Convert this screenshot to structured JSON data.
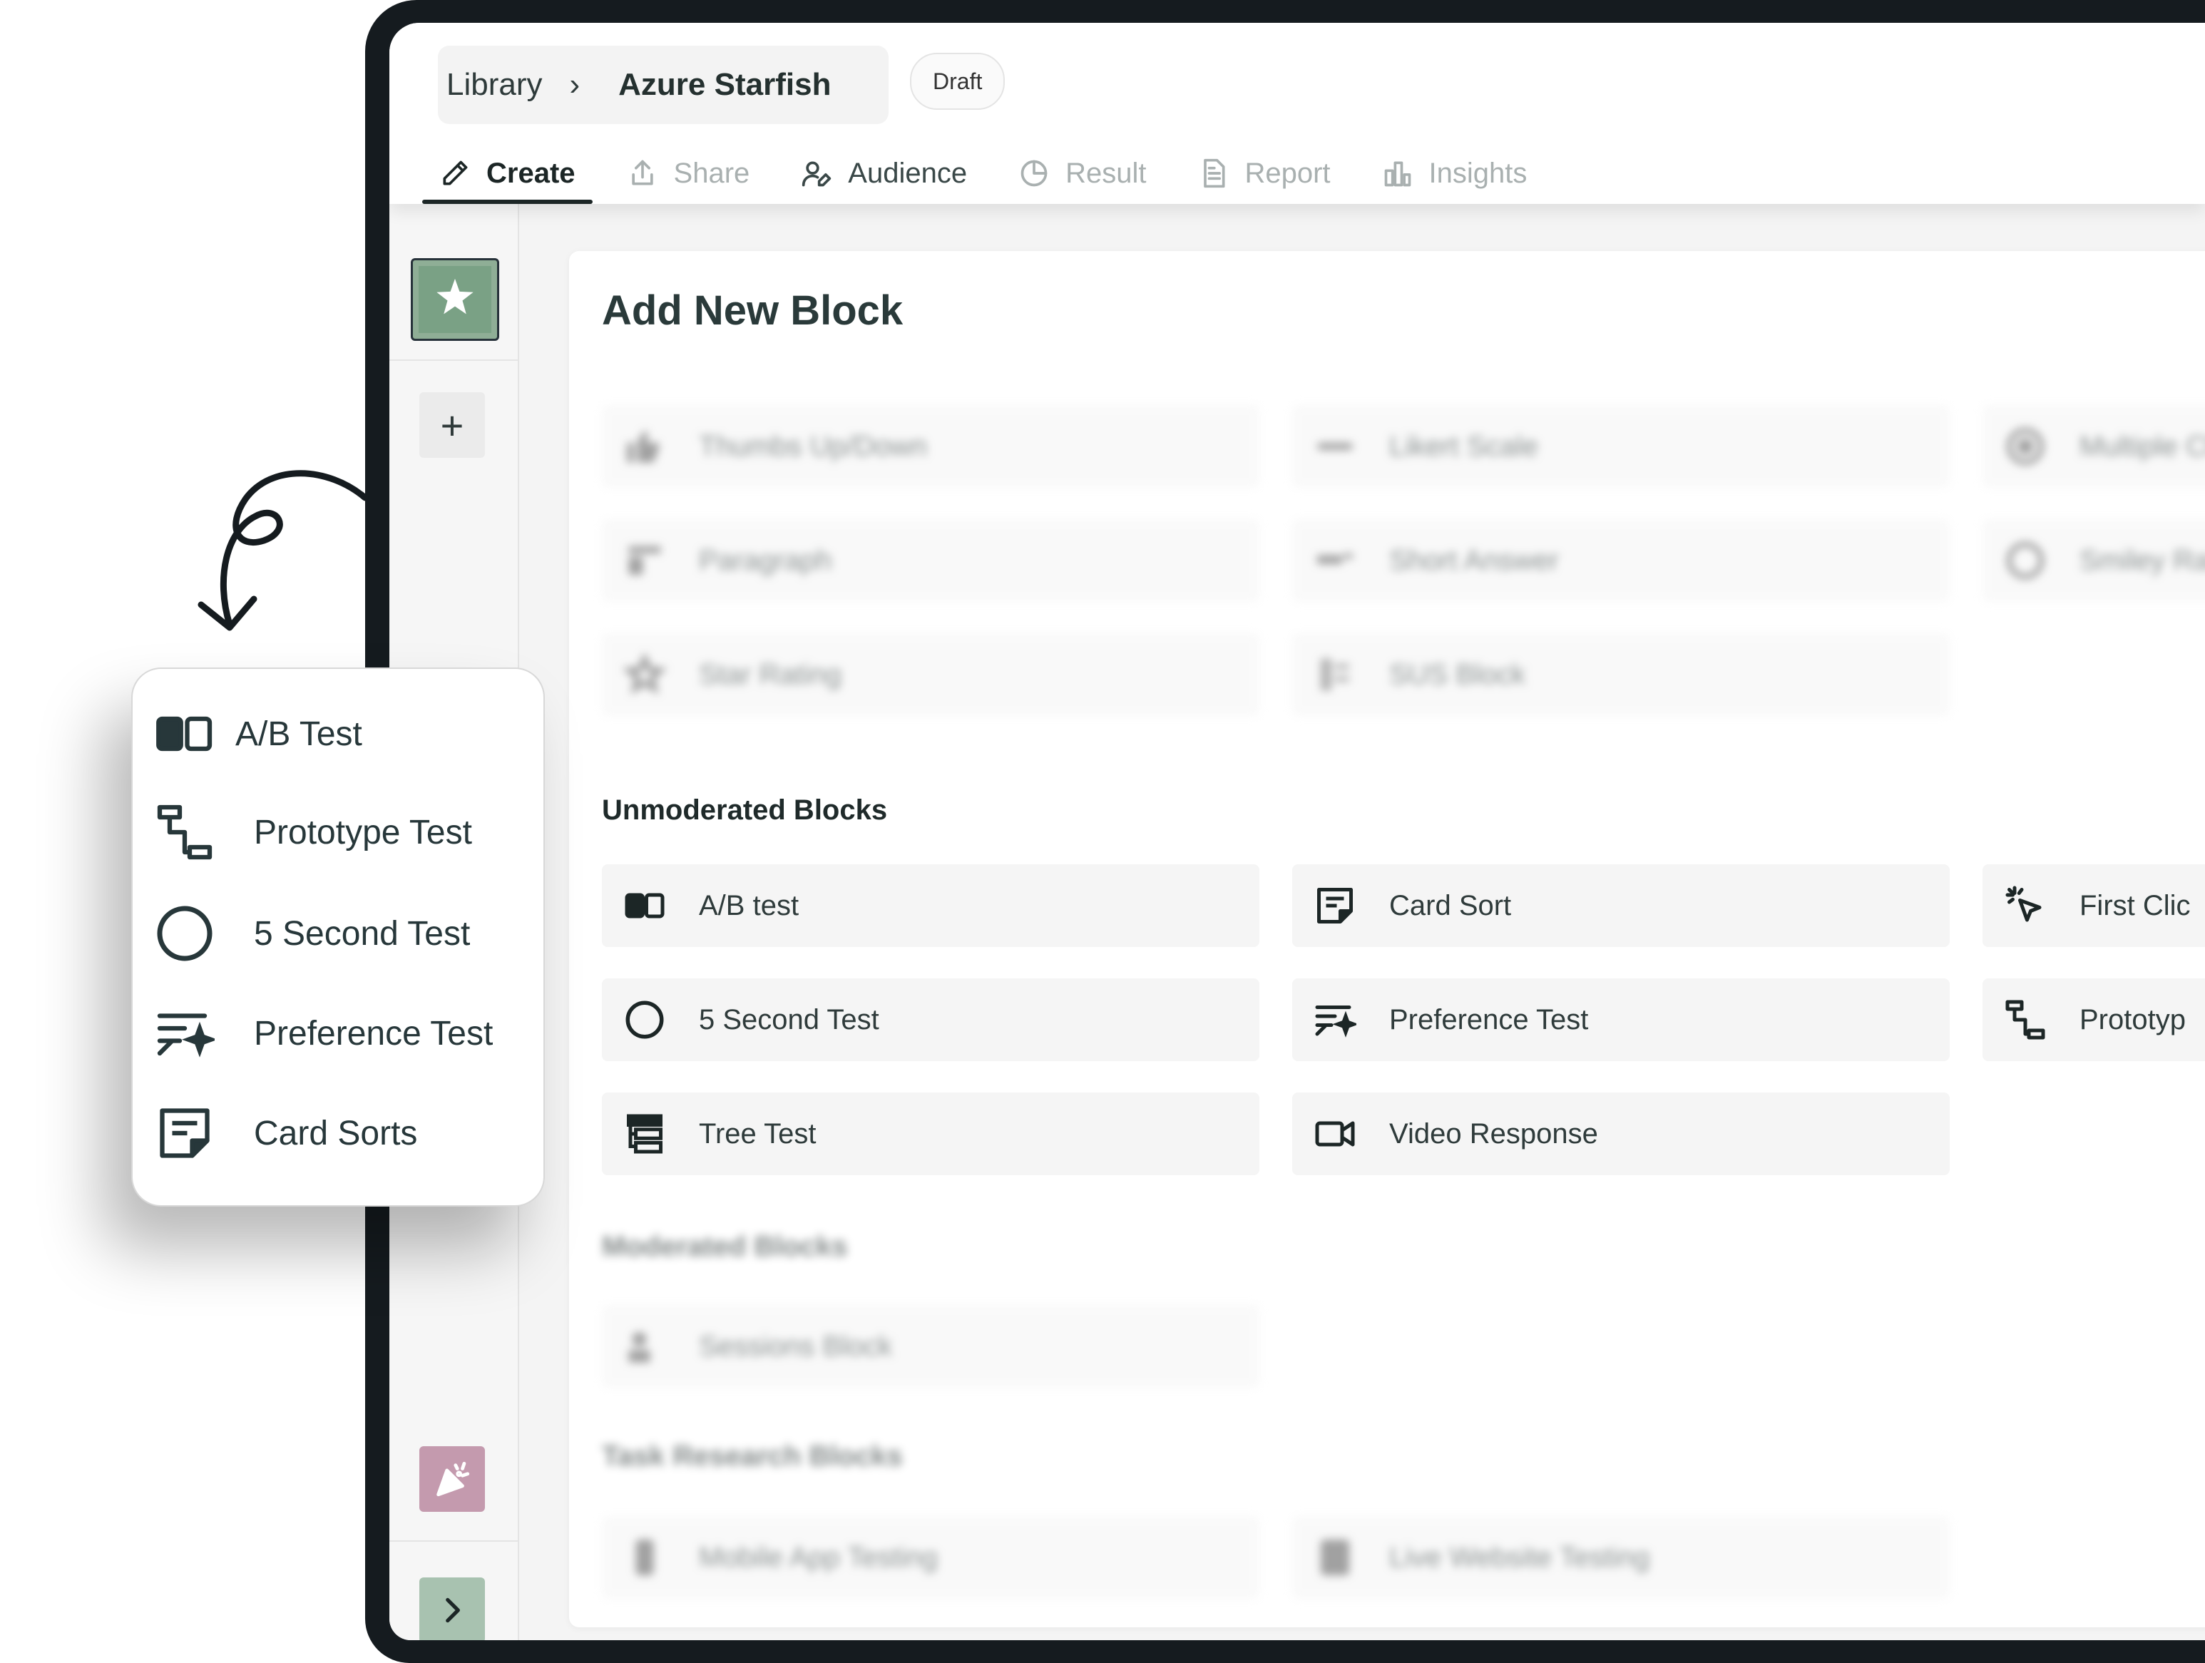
{
  "header": {
    "breadcrumb_root": "Library",
    "breadcrumb_separator": "›",
    "breadcrumb_current": "Azure Starfish",
    "status_badge": "Draft"
  },
  "tabs": [
    {
      "label": "Create",
      "icon": "pencil-icon",
      "state": "active"
    },
    {
      "label": "Share",
      "icon": "share-icon",
      "state": "disabled"
    },
    {
      "label": "Audience",
      "icon": "audience-icon",
      "state": "enabled"
    },
    {
      "label": "Result",
      "icon": "pie-chart-icon",
      "state": "disabled"
    },
    {
      "label": "Report",
      "icon": "document-icon",
      "state": "disabled"
    },
    {
      "label": "Insights",
      "icon": "bar-chart-icon",
      "state": "disabled"
    }
  ],
  "rail": {
    "add_label": "+",
    "thumbnail_icon": "starfish-icon",
    "celebrate_icon": "party-popper-icon",
    "expand_icon": "chevron-right-icon"
  },
  "panel": {
    "title": "Add New Block",
    "blurred_blocks": [
      {
        "label": "Thumbs Up/Down",
        "icon": "thumbs-icon"
      },
      {
        "label": "Likert Scale",
        "icon": "likert-icon"
      },
      {
        "label": "Multiple Choice",
        "icon": "radio-icon"
      },
      {
        "label": "Paragraph",
        "icon": "paragraph-icon"
      },
      {
        "label": "Short Answer",
        "icon": "short-answer-icon"
      },
      {
        "label": "Smiley Rating",
        "icon": "smiley-icon"
      },
      {
        "label": "Star Rating",
        "icon": "star-icon"
      },
      {
        "label": "SUS Block",
        "icon": "sus-icon"
      }
    ],
    "unmoderated_heading": "Unmoderated Blocks",
    "unmoderated_blocks": [
      {
        "label": "A/B test",
        "icon": "ab-test-icon"
      },
      {
        "label": "Card Sort",
        "icon": "card-sort-icon"
      },
      {
        "label": "First Clic",
        "icon": "cursor-click-icon"
      },
      {
        "label": "5 Second Test",
        "icon": "circle-icon"
      },
      {
        "label": "Preference Test",
        "icon": "preference-icon"
      },
      {
        "label": "Prototyp",
        "icon": "prototype-icon"
      },
      {
        "label": "Tree Test",
        "icon": "tree-test-icon"
      },
      {
        "label": "Video Response",
        "icon": "video-icon"
      }
    ],
    "moderated_heading": "Moderated Blocks",
    "moderated_blocks": [
      {
        "label": "Sessions Block",
        "icon": "sessions-icon"
      }
    ],
    "task_heading": "Task Research Blocks",
    "task_blocks": [
      {
        "label": "Mobile App Testing",
        "icon": "mobile-icon"
      },
      {
        "label": "Live Website Testing",
        "icon": "website-icon"
      }
    ]
  },
  "popup": {
    "items": [
      {
        "label": "A/B Test",
        "icon": "ab-test-icon"
      },
      {
        "label": "Prototype Test",
        "icon": "prototype-icon"
      },
      {
        "label": "5 Second Test",
        "icon": "circle-icon"
      },
      {
        "label": "Preference Test",
        "icon": "preference-icon"
      },
      {
        "label": "Card Sorts",
        "icon": "card-sort-icon"
      }
    ]
  },
  "colors": {
    "device_frame": "#151b1f",
    "accent_dark": "#1c2626",
    "thumbnail_green": "#8fae96",
    "celebrate_pink": "#c49aae",
    "expand_green": "#a8c2b0"
  }
}
